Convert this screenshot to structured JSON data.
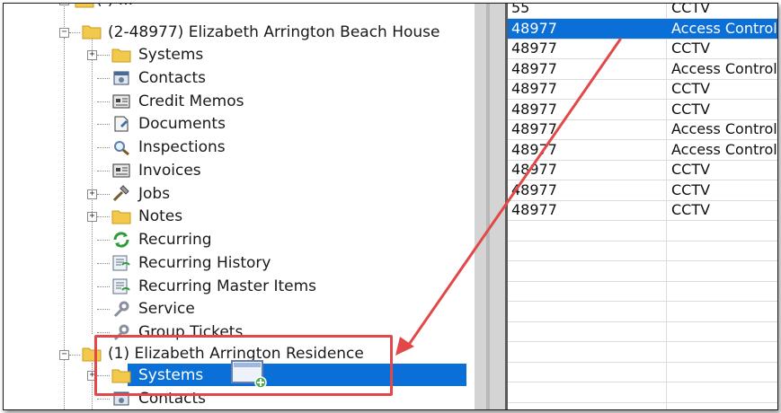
{
  "tree": {
    "top_partial": "(-) ... ",
    "site_node": "(2-48977) Elizabeth Arrington Beach House",
    "children": [
      {
        "label": "Systems",
        "icon": "folder-icon",
        "expandable": true
      },
      {
        "label": "Contacts",
        "icon": "contacts-icon",
        "expandable": false
      },
      {
        "label": "Credit Memos",
        "icon": "credit-memo-icon",
        "expandable": false
      },
      {
        "label": "Documents",
        "icon": "document-icon",
        "expandable": false
      },
      {
        "label": "Inspections",
        "icon": "magnifier-icon",
        "expandable": false
      },
      {
        "label": "Invoices",
        "icon": "invoice-icon",
        "expandable": false
      },
      {
        "label": "Jobs",
        "icon": "hammer-icon",
        "expandable": true
      },
      {
        "label": "Notes",
        "icon": "folder-icon",
        "expandable": true
      },
      {
        "label": "Recurring",
        "icon": "recurring-icon",
        "expandable": false
      },
      {
        "label": "Recurring History",
        "icon": "recurring-history-icon",
        "expandable": false
      },
      {
        "label": "Recurring Master Items",
        "icon": "recurring-master-icon",
        "expandable": false
      },
      {
        "label": "Service",
        "icon": "wrench-icon",
        "expandable": false
      },
      {
        "label": "Group Tickets",
        "icon": "wrench-icon",
        "expandable": false
      }
    ],
    "second_site_node": "(1) Elizabeth Arrington Residence",
    "second_children": [
      {
        "label": "Systems",
        "icon": "folder-icon",
        "expandable": true,
        "selected": true
      },
      {
        "label": "Contacts",
        "icon": "contacts-icon",
        "expandable": false
      }
    ]
  },
  "grid": {
    "rows": [
      {
        "c1": "55",
        "c2": "CCTV"
      },
      {
        "c1": "48977",
        "c2": "Access Control",
        "selected": true
      },
      {
        "c1": "48977",
        "c2": "CCTV"
      },
      {
        "c1": "48977",
        "c2": "Access Control"
      },
      {
        "c1": "48977",
        "c2": "CCTV"
      },
      {
        "c1": "48977",
        "c2": "CCTV"
      },
      {
        "c1": "48977",
        "c2": "Access Control"
      },
      {
        "c1": "48977",
        "c2": "Access Control"
      },
      {
        "c1": "48977",
        "c2": "CCTV"
      },
      {
        "c1": "48977",
        "c2": "CCTV"
      },
      {
        "c1": "48977",
        "c2": "CCTV"
      },
      {
        "c1": "",
        "c2": ""
      },
      {
        "c1": "",
        "c2": ""
      },
      {
        "c1": "",
        "c2": ""
      },
      {
        "c1": "",
        "c2": ""
      },
      {
        "c1": "",
        "c2": ""
      },
      {
        "c1": "",
        "c2": ""
      },
      {
        "c1": "",
        "c2": ""
      },
      {
        "c1": "",
        "c2": ""
      },
      {
        "c1": "",
        "c2": ""
      }
    ]
  },
  "colors": {
    "selection": "#0a6fd6",
    "annotation": "#e34848",
    "folder": "#f2c94c"
  },
  "drag": {
    "icon": "drag-copy-icon"
  }
}
